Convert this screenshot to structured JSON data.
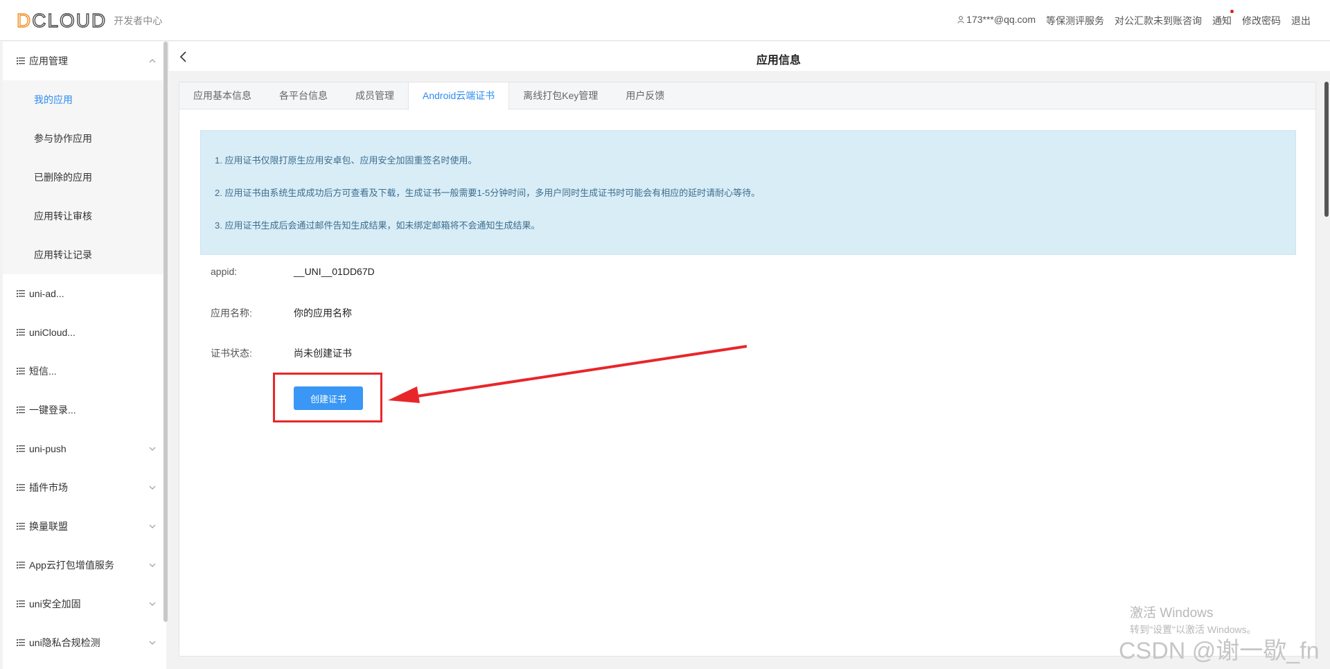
{
  "header": {
    "logo_text": "DCLOUD",
    "logo_subtitle": "开发者中心",
    "nav": {
      "user": "173***@qq.com",
      "eval_service": "等保测评服务",
      "payment_consult": "对公汇款未到账咨询",
      "notifications": "通知",
      "change_password": "修改密码",
      "logout": "退出"
    }
  },
  "sidebar": {
    "app_mgmt": {
      "label": "应用管理",
      "items": [
        "我的应用",
        "参与协作应用",
        "已删除的应用",
        "应用转让审核",
        "应用转让记录"
      ]
    },
    "groups": [
      "uni-ad...",
      "uniCloud...",
      "短信...",
      "一键登录...",
      "uni-push",
      "插件市场",
      "换量联盟",
      "App云打包增值服务",
      "uni安全加固",
      "uni隐私合规检测"
    ]
  },
  "page": {
    "title": "应用信息"
  },
  "tabs": [
    "应用基本信息",
    "各平台信息",
    "成员管理",
    "Android云端证书",
    "离线打包Key管理",
    "用户反馈"
  ],
  "notice": [
    "1. 应用证书仅限打原生应用安卓包、应用安全加固重签名时使用。",
    "2. 应用证书由系统生成成功后方可查看及下载，生成证书一般需要1-5分钟时间，多用户同时生成证书时可能会有相应的延时请耐心等待。",
    "3. 应用证书生成后会通过邮件告知生成结果，如未绑定邮箱将不会通知生成结果。"
  ],
  "fields": {
    "appid_label": "appid:",
    "appid_value": "__UNI__01DD67D",
    "name_label": "应用名称:",
    "name_value": "你的应用名称",
    "status_label": "证书状态:",
    "status_value": "尚未创建证书"
  },
  "create_button": "创建证书",
  "watermark": {
    "windows_title": "激活 Windows",
    "windows_sub": "转到\"设置\"以激活 Windows。",
    "csdn": "CSDN @谢一歇_fn"
  },
  "colors": {
    "accent": "#2d8cf0",
    "button": "#3a97f5",
    "annotation": "#e8262a",
    "notice_bg": "#d9edf7"
  }
}
